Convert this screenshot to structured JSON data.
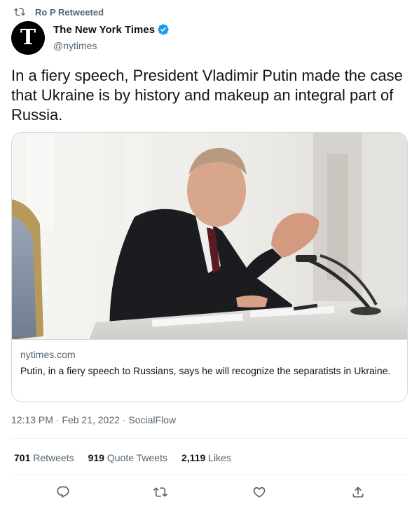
{
  "retweet_context": {
    "icon": "retweet-icon",
    "label": "Ro P Retweeted"
  },
  "author": {
    "avatar_letter": "T",
    "name": "The New York Times",
    "verified": true,
    "handle": "@nytimes"
  },
  "tweet": {
    "text": "In a fiery speech, President Vladimir Putin made the case that Ukraine is by history and makeup an integral part of Russia."
  },
  "card": {
    "image_alt": "Vladimir Putin gesturing while seated at a desk with microphones",
    "domain": "nytimes.com",
    "title": "Putin, in a fiery speech to Russians, says he will recognize the separatists in Ukraine."
  },
  "meta": {
    "time": "12:13 PM",
    "separator": "·",
    "date": "Feb 21, 2022",
    "source": "SocialFlow"
  },
  "stats": {
    "retweets_count": "701",
    "retweets_label": "Retweets",
    "quotes_count": "919",
    "quotes_label": "Quote Tweets",
    "likes_count": "2,119",
    "likes_label": "Likes"
  },
  "actions": [
    "reply-icon",
    "retweet-icon",
    "like-icon",
    "share-icon"
  ],
  "colors": {
    "text_primary": "#0f1419",
    "text_secondary": "#536471",
    "verified_blue": "#1d9bf0",
    "border": "#cfd9de"
  }
}
